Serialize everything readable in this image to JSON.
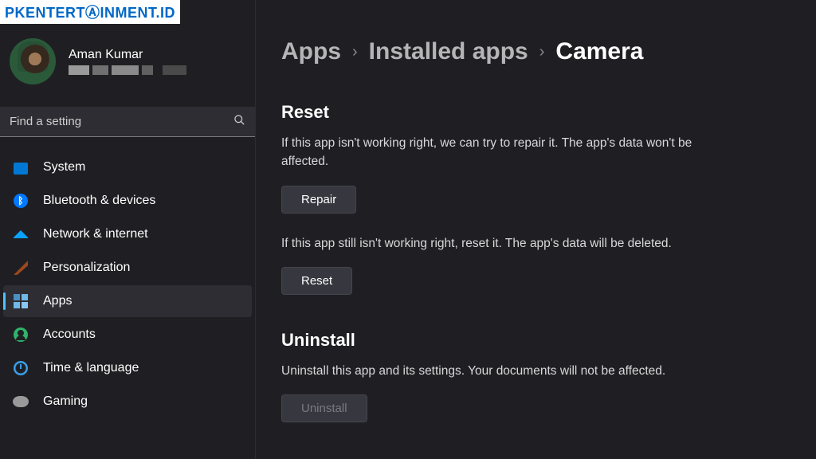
{
  "watermark": "PKENTERTⒶINMENT.ID",
  "profile": {
    "name": "Aman Kumar"
  },
  "search": {
    "placeholder": "Find a setting"
  },
  "nav": {
    "system": "System",
    "bluetooth": "Bluetooth & devices",
    "network": "Network & internet",
    "personalization": "Personalization",
    "apps": "Apps",
    "accounts": "Accounts",
    "time": "Time & language",
    "gaming": "Gaming"
  },
  "breadcrumb": {
    "level1": "Apps",
    "level2": "Installed apps",
    "level3": "Camera"
  },
  "reset": {
    "title": "Reset",
    "repair_desc": "If this app isn't working right, we can try to repair it. The app's data won't be affected.",
    "repair_btn": "Repair",
    "reset_desc": "If this app still isn't working right, reset it. The app's data will be deleted.",
    "reset_btn": "Reset"
  },
  "uninstall": {
    "title": "Uninstall",
    "desc": "Uninstall this app and its settings. Your documents will not be affected.",
    "btn": "Uninstall"
  }
}
